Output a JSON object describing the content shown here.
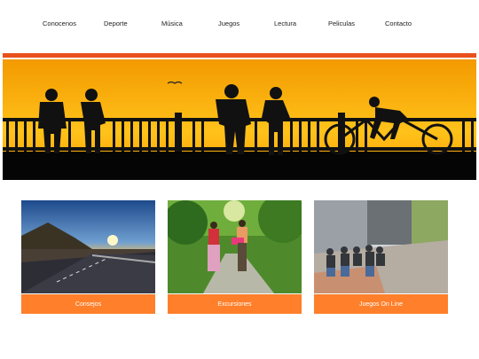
{
  "nav": {
    "items": [
      "Conocenos",
      "Deporte",
      "Música",
      "Juegos",
      "Lectura",
      "Peliculas",
      "Contacto"
    ]
  },
  "colors": {
    "accent": "#e8501c",
    "card_label_bg": "#ff7f2a",
    "sky_top": "#f5a300",
    "sky_bottom": "#ff8a00"
  },
  "cards": [
    {
      "label": "Consejos",
      "image": "road-sunset-photo"
    },
    {
      "label": "Excursiones",
      "image": "couple-walking-forest-photo"
    },
    {
      "label": "Juegos On Line",
      "image": "teens-sitting-street-photo"
    }
  ]
}
